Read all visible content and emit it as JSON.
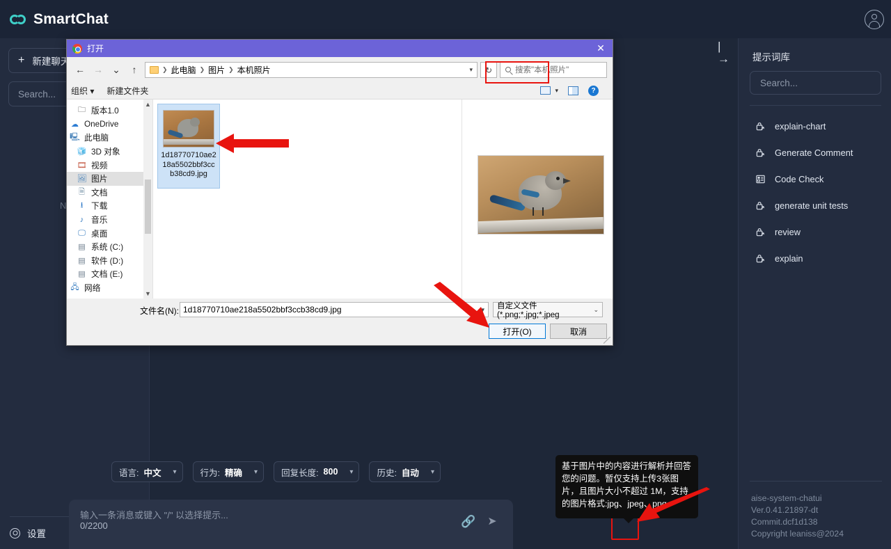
{
  "app": {
    "brand": "SmartChat",
    "avatar_icon": "user-avatar-icon"
  },
  "left_sidebar": {
    "new_chat_label": "新建聊天",
    "new_chat_plus": "+",
    "search_placeholder": "Search...",
    "empty_note": "N",
    "settings_label": "设置"
  },
  "center": {
    "collapse_icon": "panel-collapse-icon",
    "options": [
      {
        "label": "语言:",
        "value": "中文"
      },
      {
        "label": "行为:",
        "value": "精确"
      },
      {
        "label": "回复长度:",
        "value": "800"
      },
      {
        "label": "历史:",
        "value": "自动"
      }
    ],
    "composer": {
      "placeholder": "输入一条消息或键入 \"/\" 以选择提示...",
      "counter": "0/2200",
      "attach_icon": "paperclip-icon",
      "send_icon": "send-icon"
    },
    "tooltip": "基于图片中的内容进行解析并回答您的问题。暂仅支持上传3张图片，且图片大小不超过 1M，支持的图片格式:jpg、jpeg、png。"
  },
  "right_sidebar": {
    "title": "提示词库",
    "search_placeholder": "Search...",
    "prompts": [
      {
        "label": "explain-chart",
        "icon": "lock-share-icon"
      },
      {
        "label": "Generate Comment",
        "icon": "lock-share-icon"
      },
      {
        "label": "Code Check",
        "icon": "layout-list-icon"
      },
      {
        "label": "generate unit tests",
        "icon": "lock-share-icon"
      },
      {
        "label": "review",
        "icon": "lock-share-icon"
      },
      {
        "label": "explain",
        "icon": "lock-share-icon"
      }
    ],
    "version_info": [
      "aise-system-chatui",
      "Ver.0.41.21897-dt",
      "Commit.dcf1d138",
      "Copyright leaniss@2024"
    ]
  },
  "dialog": {
    "title": "打开",
    "close_label": "✕",
    "nav": {
      "back": "←",
      "forward": "→",
      "recent": "⌄",
      "up": "↑"
    },
    "breadcrumb": [
      "此电脑",
      "图片",
      "本机照片"
    ],
    "refresh_icon": "refresh-icon",
    "search_placeholder": "搜索\"本机照片\"",
    "toolbar": {
      "organize": "组织",
      "organize_caret": "▾",
      "new_folder": "新建文件夹",
      "view_caret": "▾",
      "view_icon": "view-mode-icon",
      "pane_icon": "preview-pane-icon",
      "help_icon": "help-icon"
    },
    "tree": [
      {
        "label": "版本1.0",
        "icon": "folder-icon",
        "selected": false,
        "indent": 1
      },
      {
        "label": "OneDrive",
        "icon": "cloud-icon",
        "selected": false,
        "indent": 0
      },
      {
        "label": "此电脑",
        "icon": "computer-icon",
        "selected": false,
        "indent": 0
      },
      {
        "label": "3D 对象",
        "icon": "3d-objects-icon",
        "selected": false,
        "indent": 1
      },
      {
        "label": "视频",
        "icon": "video-icon",
        "selected": false,
        "indent": 1
      },
      {
        "label": "图片",
        "icon": "pictures-icon",
        "selected": true,
        "indent": 1
      },
      {
        "label": "文档",
        "icon": "documents-icon",
        "selected": false,
        "indent": 1
      },
      {
        "label": "下载",
        "icon": "downloads-icon",
        "selected": false,
        "indent": 1
      },
      {
        "label": "音乐",
        "icon": "music-icon",
        "selected": false,
        "indent": 1
      },
      {
        "label": "桌面",
        "icon": "desktop-icon",
        "selected": false,
        "indent": 1
      },
      {
        "label": "系统 (C:)",
        "icon": "drive-system-icon",
        "selected": false,
        "indent": 1
      },
      {
        "label": "软件 (D:)",
        "icon": "drive-icon",
        "selected": false,
        "indent": 1
      },
      {
        "label": "文档 (E:)",
        "icon": "drive-icon",
        "selected": false,
        "indent": 1
      },
      {
        "label": "网络",
        "icon": "network-icon",
        "selected": false,
        "indent": 0
      }
    ],
    "file": {
      "name": "1d18770710ae218a5502bbf3ccb38cd9.jpg",
      "selected": true
    },
    "footer": {
      "filename_label": "文件名(N):",
      "filename_value": "1d18770710ae218a5502bbf3ccb38cd9.jpg",
      "filetype_value": "自定义文件 (*.png;*.jpg;*.jpeg",
      "open_button": "打开(O)",
      "cancel_button": "取消"
    }
  },
  "colors": {
    "app_bg": "#1e2738",
    "sidebar_bg": "#232c3f",
    "brand_accent": "#3fd0c9",
    "dialog_titlebar": "#6c63d8",
    "annotation_red": "#e8140f",
    "windows_button_focus": "#0078d7"
  }
}
